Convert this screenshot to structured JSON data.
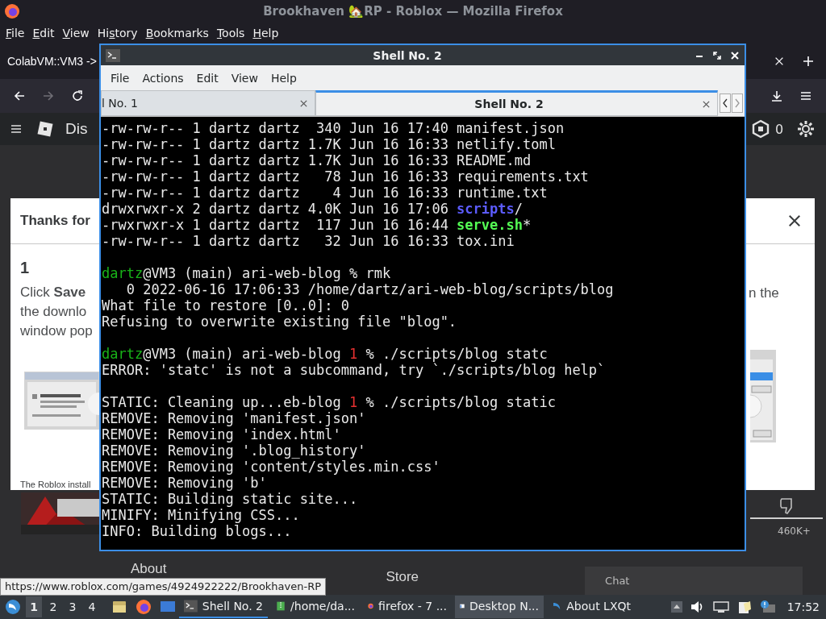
{
  "browser": {
    "title": "Brookhaven 🏡RP - Roblox — Mozilla Firefox",
    "menu": [
      {
        "access_key": "F",
        "after": "ile"
      },
      {
        "access_key": "E",
        "after": "dit"
      },
      {
        "access_key": "V",
        "after": "iew"
      },
      {
        "before": "Hi",
        "access_key": "s",
        "after": "tory"
      },
      {
        "access_key": "B",
        "after": "ookmarks"
      },
      {
        "access_key": "T",
        "after": "ools"
      },
      {
        "access_key": "H",
        "after": "elp"
      }
    ],
    "tab": {
      "label": "ColabVM::VM3 ->"
    },
    "status_url": "https://www.roblox.com/games/4924922222/Brookhaven-RP"
  },
  "page": {
    "header": {
      "title": "Dis",
      "robux": "0"
    },
    "dialog": {
      "title": "Thanks for",
      "step": "1",
      "lines_left": [
        "Click **Save**",
        "the downlo",
        "window pop"
      ],
      "line_right": "n the",
      "caption": "The Roblox install"
    },
    "dislikes": "460K+",
    "footer_tabs": [
      "About",
      "Store"
    ],
    "chat": "Chat"
  },
  "terminal": {
    "title": "Shell No. 2",
    "menu": [
      "File",
      "Actions",
      "Edit",
      "View",
      "Help"
    ],
    "tabs": [
      {
        "label": "l No. 1",
        "selected": false
      },
      {
        "label": "Shell No. 2",
        "selected": true
      }
    ],
    "lines": [
      {
        "spans": [
          {
            "text": "-rw-rw-r-- 1 dartz dartz  340 Jun 16 17:40 manifest.json",
            "kind": "plain"
          }
        ]
      },
      {
        "spans": [
          {
            "text": "-rw-rw-r-- 1 dartz dartz 1.7K Jun 16 16:33 netlify.toml",
            "kind": "plain"
          }
        ]
      },
      {
        "spans": [
          {
            "text": "-rw-rw-r-- 1 dartz dartz 1.7K Jun 16 16:33 README.md",
            "kind": "plain"
          }
        ]
      },
      {
        "spans": [
          {
            "text": "-rw-rw-r-- 1 dartz dartz   78 Jun 16 16:33 requirements.txt",
            "kind": "plain"
          }
        ]
      },
      {
        "spans": [
          {
            "text": "-rw-rw-r-- 1 dartz dartz    4 Jun 16 16:33 runtime.txt",
            "kind": "plain"
          }
        ]
      },
      {
        "spans": [
          {
            "text": "drwxrwxr-x 2 dartz dartz 4.0K Jun 16 17:06 ",
            "kind": "plain"
          },
          {
            "text": "scripts",
            "kind": "directory"
          },
          {
            "text": "/",
            "kind": "plain"
          }
        ]
      },
      {
        "spans": [
          {
            "text": "-rwxrwxr-x 1 dartz dartz  117 Jun 16 16:44 ",
            "kind": "plain"
          },
          {
            "text": "serve.sh",
            "kind": "executable"
          },
          {
            "text": "*",
            "kind": "plain"
          }
        ]
      },
      {
        "spans": [
          {
            "text": "-rw-rw-r-- 1 dartz dartz   32 Jun 16 16:33 tox.ini",
            "kind": "plain"
          }
        ]
      },
      {
        "kind": "blank"
      },
      {
        "spans": [
          {
            "text": "dartz",
            "kind": "user"
          },
          {
            "text": "@VM3 (main) ari-web-blog % rmk",
            "kind": "plain"
          }
        ]
      },
      {
        "spans": [
          {
            "text": "   0 2022-06-16 17:06:33 /home/dartz/ari-web-blog/scripts/blog",
            "kind": "plain"
          }
        ]
      },
      {
        "spans": [
          {
            "text": "What file to restore [0..0]: 0",
            "kind": "plain"
          }
        ]
      },
      {
        "spans": [
          {
            "text": "Refusing to overwrite existing file \"blog\".",
            "kind": "plain"
          }
        ]
      },
      {
        "kind": "blank"
      },
      {
        "spans": [
          {
            "text": "dartz",
            "kind": "user"
          },
          {
            "text": "@VM3 (main) ari-web-blog ",
            "kind": "plain"
          },
          {
            "text": "1",
            "kind": "status"
          },
          {
            "text": " % ./scripts/blog statc",
            "kind": "plain"
          }
        ]
      },
      {
        "spans": [
          {
            "text": "ERROR: 'statc' is not a subcommand, try `./scripts/blog help`",
            "kind": "plain"
          }
        ]
      },
      {
        "kind": "blank"
      },
      {
        "spans": [
          {
            "text": "STATIC: Cleaning up...eb-blog ",
            "kind": "plain"
          },
          {
            "text": "1",
            "kind": "status"
          },
          {
            "text": " % ./scripts/blog static",
            "kind": "plain"
          }
        ]
      },
      {
        "spans": [
          {
            "text": "REMOVE: Removing 'manifest.json'",
            "kind": "plain"
          }
        ]
      },
      {
        "spans": [
          {
            "text": "REMOVE: Removing 'index.html'",
            "kind": "plain"
          }
        ]
      },
      {
        "spans": [
          {
            "text": "REMOVE: Removing '.blog_history'",
            "kind": "plain"
          }
        ]
      },
      {
        "spans": [
          {
            "text": "REMOVE: Removing 'content/styles.min.css'",
            "kind": "plain"
          }
        ]
      },
      {
        "spans": [
          {
            "text": "REMOVE: Removing 'b'",
            "kind": "plain"
          }
        ]
      },
      {
        "spans": [
          {
            "text": "STATIC: Building static site...",
            "kind": "plain"
          }
        ]
      },
      {
        "spans": [
          {
            "text": "MINIFY: Minifying CSS...",
            "kind": "plain"
          }
        ]
      },
      {
        "spans": [
          {
            "text": "INFO: Building blogs...",
            "kind": "plain"
          }
        ]
      }
    ]
  },
  "taskbar": {
    "desktops": [
      {
        "label": "1",
        "selected": true
      },
      {
        "label": "2",
        "selected": false
      },
      {
        "label": "3",
        "selected": false
      },
      {
        "label": "4",
        "selected": false
      }
    ],
    "tasks": [
      {
        "label": "Shell No. 2",
        "kind": "terminal",
        "selected": true,
        "hovered": false
      },
      {
        "label": "/home/da...",
        "kind": "archive",
        "selected": false,
        "hovered": false
      },
      {
        "label": "firefox - 7 ...",
        "kind": "firefox",
        "selected": false,
        "hovered": false
      },
      {
        "label": "Desktop N...",
        "kind": "desktop",
        "selected": false,
        "hovered": true
      },
      {
        "label": "About LXQt",
        "kind": "lxqt",
        "selected": false,
        "hovered": false
      }
    ],
    "clock": "17:52"
  }
}
